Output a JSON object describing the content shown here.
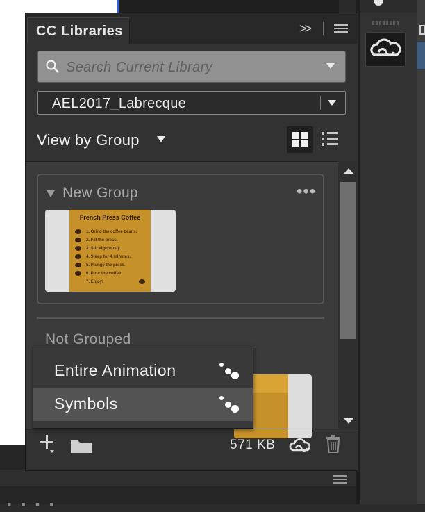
{
  "panel": {
    "title": "CC Libraries",
    "collapse_icon": "double-chevron-right-icon",
    "menu_icon": "hamburger-menu-icon"
  },
  "search": {
    "placeholder": "Search Current Library",
    "icon": "search-icon"
  },
  "library_select": {
    "value": "AEL2017_Labrecque"
  },
  "view": {
    "label": "View by Group",
    "grid_icon": "grid-view-icon",
    "list_icon": "list-view-icon",
    "active": "grid"
  },
  "groups": [
    {
      "name": "New Group",
      "more_icon": "ellipsis-icon",
      "asset": {
        "title": "French Press Coffee",
        "steps": [
          "1. Grind the coffee beans.",
          "2. Fill the press.",
          "3. Stir vigorously.",
          "4. Steep for 4 minutes.",
          "5. Plunge the press.",
          "6. Pour the coffee.",
          "7. Enjoy!"
        ]
      }
    }
  ],
  "ungrouped": {
    "label": "Not Grouped"
  },
  "popup_menu": {
    "items": [
      {
        "label": "Entire Animation",
        "icon": "animate-dots-icon"
      },
      {
        "label": "Symbols",
        "icon": "animate-dots-icon"
      }
    ],
    "highlighted_index": 1
  },
  "footer": {
    "add_icon": "plus-icon",
    "folder_icon": "folder-icon",
    "library_size": "571 KB",
    "cc_icon": "creative-cloud-icon",
    "trash_icon": "trash-icon"
  },
  "colors": {
    "panel_bg": "#323232",
    "content_bg": "#3b3b3b",
    "search_bg": "#919191",
    "highlight": "#535353",
    "thumb_orange": "#c7912a"
  }
}
